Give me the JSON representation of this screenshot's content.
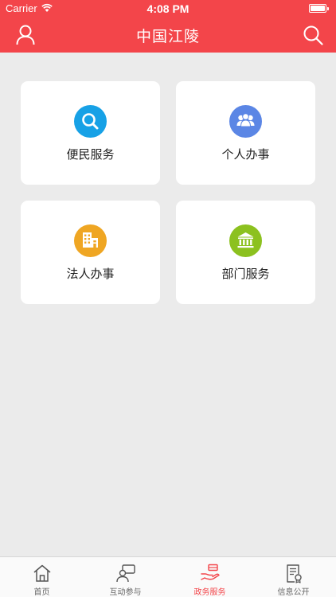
{
  "status_bar": {
    "carrier": "Carrier",
    "time": "4:08 PM"
  },
  "header": {
    "title": "中国江陵",
    "left_icon": "user-icon",
    "right_icon": "search-icon"
  },
  "colors": {
    "brand": "#f3454a",
    "background": "#ebebeb",
    "tab_inactive": "#666666"
  },
  "services": [
    {
      "label": "便民服务",
      "icon": "search-icon",
      "color": "#17a1e6"
    },
    {
      "label": "个人办事",
      "icon": "people-icon",
      "color": "#5b86e5"
    },
    {
      "label": "法人办事",
      "icon": "building-icon",
      "color": "#efa623"
    },
    {
      "label": "部门服务",
      "icon": "bank-icon",
      "color": "#8cc11f"
    }
  ],
  "tabs": [
    {
      "label": "首页",
      "icon": "home-icon",
      "active": false
    },
    {
      "label": "互动参与",
      "icon": "chat-icon",
      "active": false
    },
    {
      "label": "政务服务",
      "icon": "hand-service-icon",
      "active": true
    },
    {
      "label": "信息公开",
      "icon": "document-icon",
      "active": false
    }
  ]
}
